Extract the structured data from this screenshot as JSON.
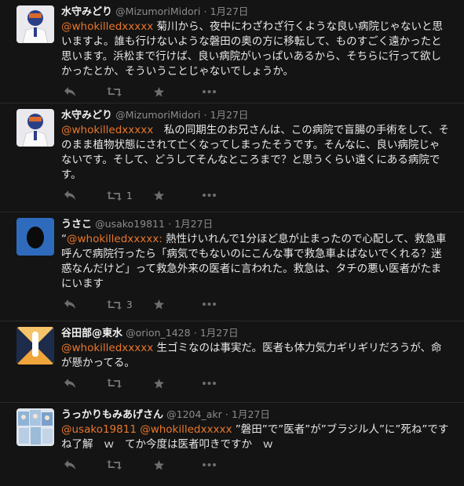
{
  "tweets": [
    {
      "name": "水守みどり",
      "handle": "@MizumoriMidori",
      "sep": "·",
      "date": "1月27日",
      "mention": "@whokilledxxxxx",
      "body": " 菊川から、夜中にわざわざ行くような良い病院じゃないと思いますよ。誰も行けないような磐田の奥の方に移転して、ものすごく遠かったと思います。浜松まで行けば、良い病院がいっぱいあるから、そちらに行って欲しかったとか、そういうことじゃないでしょうか。",
      "retweet_count": "",
      "avatar": "doctor-avatar"
    },
    {
      "name": "水守みどり",
      "handle": "@MizumoriMidori",
      "sep": "·",
      "date": "1月27日",
      "mention": "@whokilledxxxxx",
      "body": "　私の同期生のお兄さんは、この病院で盲腸の手術をして、そのまま植物状態にされて亡くなってしまったそうです。そんなに、良い病院じゃないです。そして、どうしてそんなところまで？と思うくらい遠くにある病院です。",
      "retweet_count": "1",
      "avatar": "doctor-avatar"
    },
    {
      "name": "うさこ",
      "handle": "@usako19811",
      "sep": "·",
      "date": "1月27日",
      "prefix": "“",
      "mention": "@whokilledxxxxx:",
      "body": " 熱性けいれんで1分ほど息が止まったので心配して、救急車呼んで病院行ったら「病気でもないのにこんな事で救急車よばないでくれる？迷惑なんだけど」って救急外来の医者に言われた。救急は、タチの悪い医者がたまにいます",
      "retweet_count": "3",
      "avatar": "egg-avatar"
    },
    {
      "name": "谷田部@東水",
      "handle": "@orion_1428",
      "sep": "·",
      "date": "1月27日",
      "mention": "@whokilledxxxxx",
      "body": " 生ゴミなのは事実だ。医者も体力気力ギリギリだろうが、命が懸かってる。",
      "retweet_count": "",
      "avatar": "orion-avatar"
    },
    {
      "name": "うっかりもみあげさん",
      "handle": "@1204_akr",
      "sep": "·",
      "date": "1月27日",
      "mention": "@usako19811",
      "mention2": "@whokilledxxxxx",
      "body": " ”磐田”で”医者”が”ブラジル人”に”死ね”ですね了解　ｗ　てか今度は医者叩きですか　ｗ",
      "retweet_count": "",
      "avatar": "anime-avatar"
    }
  ],
  "colors": {
    "background": "#141414",
    "mention": "#e8762b",
    "meta": "#8c8c8c",
    "icon": "#6e6e6e"
  }
}
